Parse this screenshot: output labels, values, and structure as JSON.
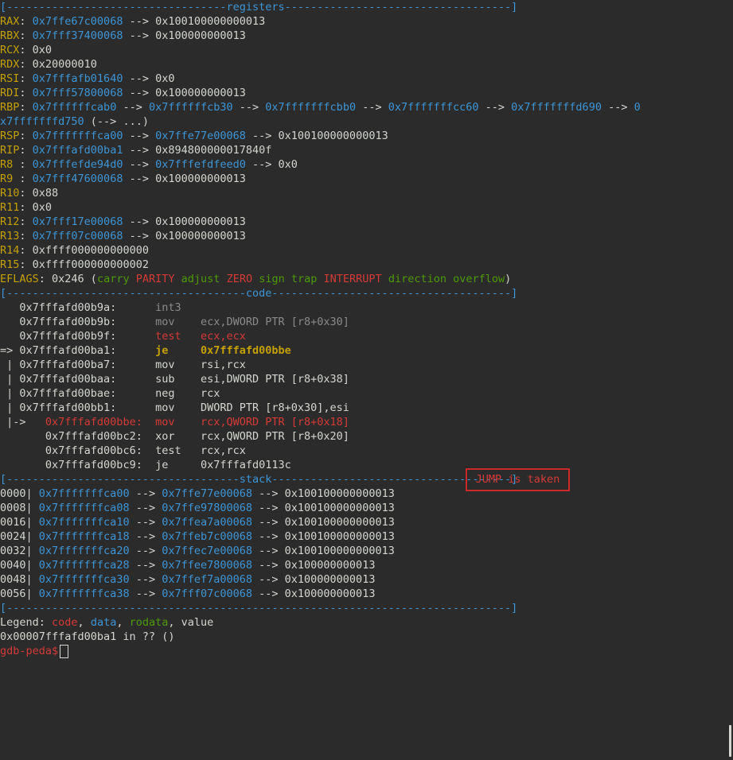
{
  "separators": {
    "registers": "[----------------------------------registers-----------------------------------]",
    "code": "[-------------------------------------code-------------------------------------]",
    "stack_left": "[------------------------------------stack",
    "stack_right": "-------------------------------------]",
    "end": "[------------------------------------------------------------------------------]"
  },
  "registers": [
    {
      "name": "RAX",
      "sep": ": ",
      "v1": "0x7ffe67c00068",
      "a1": " --> ",
      "v2": "0x100100000000013"
    },
    {
      "name": "RBX",
      "sep": ": ",
      "v1": "0x7fff37400068",
      "a1": " --> ",
      "v2": "0x100000000013"
    },
    {
      "name": "RCX",
      "sep": ": ",
      "v1": "",
      "a1": "",
      "v2": "0x0"
    },
    {
      "name": "RDX",
      "sep": ": ",
      "v1": "",
      "a1": "",
      "v2": "0x20000010"
    },
    {
      "name": "RSI",
      "sep": ": ",
      "v1": "0x7fffafb01640",
      "a1": " --> ",
      "v2": "0x0"
    },
    {
      "name": "RDI",
      "sep": ": ",
      "v1": "0x7fff57800068",
      "a1": " --> ",
      "v2": "0x100000000013"
    }
  ],
  "rbp": {
    "name": "RBP",
    "sep": ": ",
    "chain": [
      "0x7ffffffcab0",
      "0x7ffffffcb30",
      "0x7fffffffcbb0",
      "0x7fffffffcc60",
      "0x7fffffffd690"
    ],
    "arrow": " --> ",
    "wrap_a": "0",
    "wrap_b": "x7fffffffd750",
    "wrap_c": " (--> ...)"
  },
  "registers2": [
    {
      "name": "RSP",
      "sep": ": ",
      "v1": "0x7fffffffca00",
      "a1": " --> ",
      "v2b": "0x7ffe77e00068",
      "a2": " --> ",
      "v3": "0x100100000000013"
    },
    {
      "name": "RIP",
      "sep": ": ",
      "v1": "0x7fffafd00ba1",
      "a1": " --> ",
      "v2b": "",
      "a2": "",
      "v3": "0x894800000017840f"
    },
    {
      "name": "R8 ",
      "sep": ": ",
      "v1": "0x7fffefde94d0",
      "a1": " --> ",
      "v2b": "0x7fffefdfeed0",
      "a2": " --> ",
      "v3": "0x0"
    },
    {
      "name": "R9 ",
      "sep": ": ",
      "v1": "0x7fff47600068",
      "a1": " --> ",
      "v2b": "",
      "a2": "",
      "v3": "0x100000000013"
    },
    {
      "name": "R10",
      "sep": ": ",
      "v1": "",
      "a1": "",
      "v2b": "",
      "a2": "",
      "v3": "0x88"
    },
    {
      "name": "R11",
      "sep": ": ",
      "v1": "",
      "a1": "",
      "v2b": "",
      "a2": "",
      "v3": "0x0"
    },
    {
      "name": "R12",
      "sep": ": ",
      "v1": "0x7fff17e00068",
      "a1": " --> ",
      "v2b": "",
      "a2": "",
      "v3": "0x100000000013"
    },
    {
      "name": "R13",
      "sep": ": ",
      "v1": "0x7fff07c00068",
      "a1": " --> ",
      "v2b": "",
      "a2": "",
      "v3": "0x100000000013"
    },
    {
      "name": "R14",
      "sep": ": ",
      "v1": "",
      "a1": "",
      "v2b": "",
      "a2": "",
      "v3": "0xffff000000000000"
    },
    {
      "name": "R15",
      "sep": ": ",
      "v1": "",
      "a1": "",
      "v2b": "",
      "a2": "",
      "v3": "0xffff000000000002"
    }
  ],
  "eflags": {
    "name": "EFLAGS",
    "value": ": 0x246 (",
    "flags": [
      {
        "t": "carry",
        "on": false
      },
      {
        "t": "PARITY",
        "on": true
      },
      {
        "t": "adjust",
        "on": false
      },
      {
        "t": "ZERO",
        "on": true
      },
      {
        "t": "sign",
        "on": false
      },
      {
        "t": "trap",
        "on": false
      },
      {
        "t": "INTERRUPT",
        "on": true
      },
      {
        "t": "direction",
        "on": false
      },
      {
        "t": "overflow",
        "on": false
      }
    ],
    "close": ")"
  },
  "code": [
    {
      "prefix": "   ",
      "addr": "0x7fffafd00b9a:",
      "pad": "      ",
      "mn": "int3",
      "ops": "",
      "style": "g"
    },
    {
      "prefix": "   ",
      "addr": "0x7fffafd00b9b:",
      "pad": "      ",
      "mn": "mov    ",
      "ops": "ecx,DWORD PTR [r8+0x30]",
      "style": "g"
    },
    {
      "prefix": "   ",
      "addr": "0x7fffafd00b9f:",
      "pad": "      ",
      "mn": "test   ",
      "ops": "ecx,ecx",
      "style": "r"
    },
    {
      "prefix": "=> ",
      "addr": "0x7fffafd00ba1:",
      "pad": "      ",
      "mn": "je     ",
      "ops": "0x7fffafd00bbe",
      "style": "cur"
    },
    {
      "prefix": " | ",
      "addr": "0x7fffafd00ba7:",
      "pad": "      ",
      "mn": "mov    ",
      "ops": "rsi,rcx",
      "style": "w"
    },
    {
      "prefix": " | ",
      "addr": "0x7fffafd00baa:",
      "pad": "      ",
      "mn": "sub    ",
      "ops": "esi,DWORD PTR [r8+0x38]",
      "style": "w"
    },
    {
      "prefix": " | ",
      "addr": "0x7fffafd00bae:",
      "pad": "      ",
      "mn": "neg    ",
      "ops": "rcx",
      "style": "w"
    },
    {
      "prefix": " | ",
      "addr": "0x7fffafd00bb1:",
      "pad": "      ",
      "mn": "mov    ",
      "ops": "DWORD PTR [r8+0x30],esi",
      "style": "w"
    },
    {
      "prefix": " |->   ",
      "addr": "0x7fffafd00bbe:",
      "pad": "  ",
      "mn": "mov    ",
      "ops": "rcx,QWORD PTR [r8+0x18]",
      "style": "r"
    },
    {
      "prefix": "       ",
      "addr": "0x7fffafd00bc2:",
      "pad": "  ",
      "mn": "xor    ",
      "ops": "rcx,QWORD PTR [r8+0x20]",
      "style": "w"
    },
    {
      "prefix": "       ",
      "addr": "0x7fffafd00bc6:",
      "pad": "  ",
      "mn": "test   ",
      "ops": "rcx,rcx",
      "style": "w"
    },
    {
      "prefix": "       ",
      "addr": "0x7fffafd00bc9:",
      "pad": "  ",
      "mn": "je     ",
      "ops": "0x7fffafd0113c",
      "style": "w"
    }
  ],
  "jump_label": "JUMP is taken",
  "stack": [
    {
      "off": "0000",
      "a": "0x7fffffffca00",
      "b": "0x7ffe77e00068",
      "c": "0x100100000000013"
    },
    {
      "off": "0008",
      "a": "0x7fffffffca08",
      "b": "0x7ffe97800068",
      "c": "0x100100000000013"
    },
    {
      "off": "0016",
      "a": "0x7fffffffca10",
      "b": "0x7ffea7a00068",
      "c": "0x100100000000013"
    },
    {
      "off": "0024",
      "a": "0x7fffffffca18",
      "b": "0x7ffeb7c00068",
      "c": "0x100100000000013"
    },
    {
      "off": "0032",
      "a": "0x7fffffffca20",
      "b": "0x7ffec7e00068",
      "c": "0x100100000000013"
    },
    {
      "off": "0040",
      "a": "0x7fffffffca28",
      "b": "0x7ffee7800068",
      "c": "0x100000000013"
    },
    {
      "off": "0048",
      "a": "0x7fffffffca30",
      "b": "0x7ffef7a00068",
      "c": "0x100000000013"
    },
    {
      "off": "0056",
      "a": "0x7fffffffca38",
      "b": "0x7fff07c00068",
      "c": "0x100000000013"
    }
  ],
  "legend": {
    "label": "Legend: ",
    "code": "code",
    "data": "data",
    "rodata": "rodata",
    "value": "value",
    "comma": ", "
  },
  "location": "0x00007fffafd00ba1 in ?? ()",
  "prompt": "gdb-peda$"
}
